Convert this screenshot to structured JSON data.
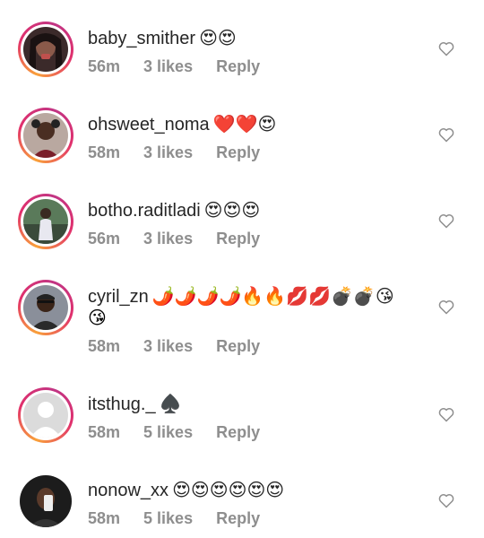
{
  "comments": [
    {
      "username": "baby_smither",
      "text": "😍😍",
      "time": "56m",
      "likes": "3 likes",
      "reply": "Reply",
      "avatar": "avatar-woman-1"
    },
    {
      "username": "ohsweet_noma",
      "text": "❤️❤️😍",
      "time": "58m",
      "likes": "3 likes",
      "reply": "Reply",
      "avatar": "avatar-woman-2"
    },
    {
      "username": "botho.raditladi",
      "text": "😍😍😍",
      "time": "56m",
      "likes": "3 likes",
      "reply": "Reply",
      "avatar": "avatar-woman-3"
    },
    {
      "username": "cyril_zn",
      "text": "🌶️🌶️🌶️🌶️🔥🔥💋💋💣💣😘",
      "text_line2": "😘",
      "time": "58m",
      "likes": "3 likes",
      "reply": "Reply",
      "avatar": "avatar-man-1"
    },
    {
      "username": "itsthug._",
      "text": "♠️",
      "time": "58m",
      "likes": "5 likes",
      "reply": "Reply",
      "avatar": "avatar-default"
    },
    {
      "username": "nonow_xx",
      "text": "😍😍😍😍😍😍",
      "time": "58m",
      "likes": "5 likes",
      "reply": "Reply",
      "avatar": "avatar-selfie"
    }
  ],
  "colors": {
    "username": "#262626",
    "meta": "#8e8e8e",
    "ring_start": "#f9a13a",
    "ring_end": "#c13584"
  },
  "icons": {
    "like": "heart-outline-icon"
  }
}
